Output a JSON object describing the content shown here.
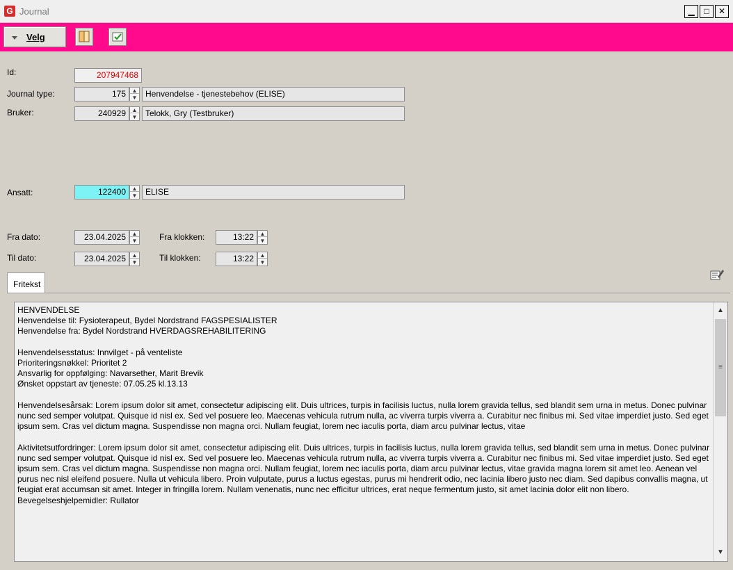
{
  "window": {
    "title": "Journal",
    "app_icon": "G",
    "controls": {
      "minimize": "▁",
      "maximize": "□",
      "close": "✕"
    }
  },
  "toolbar": {
    "velg_label": "Velg",
    "icons": [
      "book-icon",
      "checkbox-check-icon"
    ],
    "accent_color": "#ff0a8c"
  },
  "form": {
    "id_label": "Id:",
    "id_value": "207947468",
    "journal_type_label": "Journal type:",
    "journal_type_code": "175",
    "journal_type_name": "Henvendelse - tjenestebehov (ELISE)",
    "bruker_label": "Bruker:",
    "bruker_code": "240929",
    "bruker_name": "Telokk, Gry (Testbruker)",
    "ansatt_label": "Ansatt:",
    "ansatt_code": "122400",
    "ansatt_name": "ELISE",
    "fra_dato_label": "Fra dato:",
    "fra_dato_value": "23.04.2025",
    "fra_klokken_label": "Fra klokken:",
    "fra_klokken_value": "13:22",
    "til_dato_label": "Til dato:",
    "til_dato_value": "23.04.2025",
    "til_klokken_label": "Til klokken:",
    "til_klokken_value": "13:22"
  },
  "tabs": [
    {
      "label": "Fritekst"
    }
  ],
  "fritekst": {
    "text": "HENVENDELSE\nHenvendelse til: Fysioterapeut, Bydel Nordstrand FAGSPESIALISTER\nHenvendelse fra: Bydel Nordstrand HVERDAGSREHABILITERING\n\nHenvendelsesstatus: Innvilget - på venteliste\nPrioriteringsnøkkel: Prioritet 2\nAnsvarlig for oppfølging: Navarsether, Marit Brevik\nØnsket oppstart av tjeneste: 07.05.25 kl.13.13\n\nHenvendelsesårsak: Lorem ipsum dolor sit amet, consectetur adipiscing elit. Duis ultrices, turpis in facilisis luctus, nulla lorem gravida tellus, sed blandit sem urna in metus. Donec pulvinar nunc sed semper volutpat. Quisque id nisl ex. Sed vel posuere leo. Maecenas vehicula rutrum nulla, ac viverra turpis viverra a. Curabitur nec finibus mi. Sed vitae imperdiet justo. Sed eget ipsum sem. Cras vel dictum magna. Suspendisse non magna orci. Nullam feugiat, lorem nec iaculis porta, diam arcu pulvinar lectus, vitae\n\nAktivitetsutfordringer: Lorem ipsum dolor sit amet, consectetur adipiscing elit. Duis ultrices, turpis in facilisis luctus, nulla lorem gravida tellus, sed blandit sem urna in metus. Donec pulvinar nunc sed semper volutpat. Quisque id nisl ex. Sed vel posuere leo. Maecenas vehicula rutrum nulla, ac viverra turpis viverra a. Curabitur nec finibus mi. Sed vitae imperdiet justo. Sed eget ipsum sem. Cras vel dictum magna. Suspendisse non magna orci. Nullam feugiat, lorem nec iaculis porta, diam arcu pulvinar lectus, vitae gravida magna lorem sit amet leo. Aenean vel purus nec nisl eleifend posuere. Nulla ut vehicula libero. Proin vulputate, purus a luctus egestas, purus mi hendrerit odio, nec lacinia libero justo nec diam. Sed dapibus convallis magna, ut feugiat erat accumsan sit amet. Integer in fringilla lorem. Nullam venenatis, nunc nec efficitur ultrices, erat neque fermentum justo, sit amet lacinia dolor elit non libero.\nBevegelseshjelpemidler: Rullator"
  }
}
